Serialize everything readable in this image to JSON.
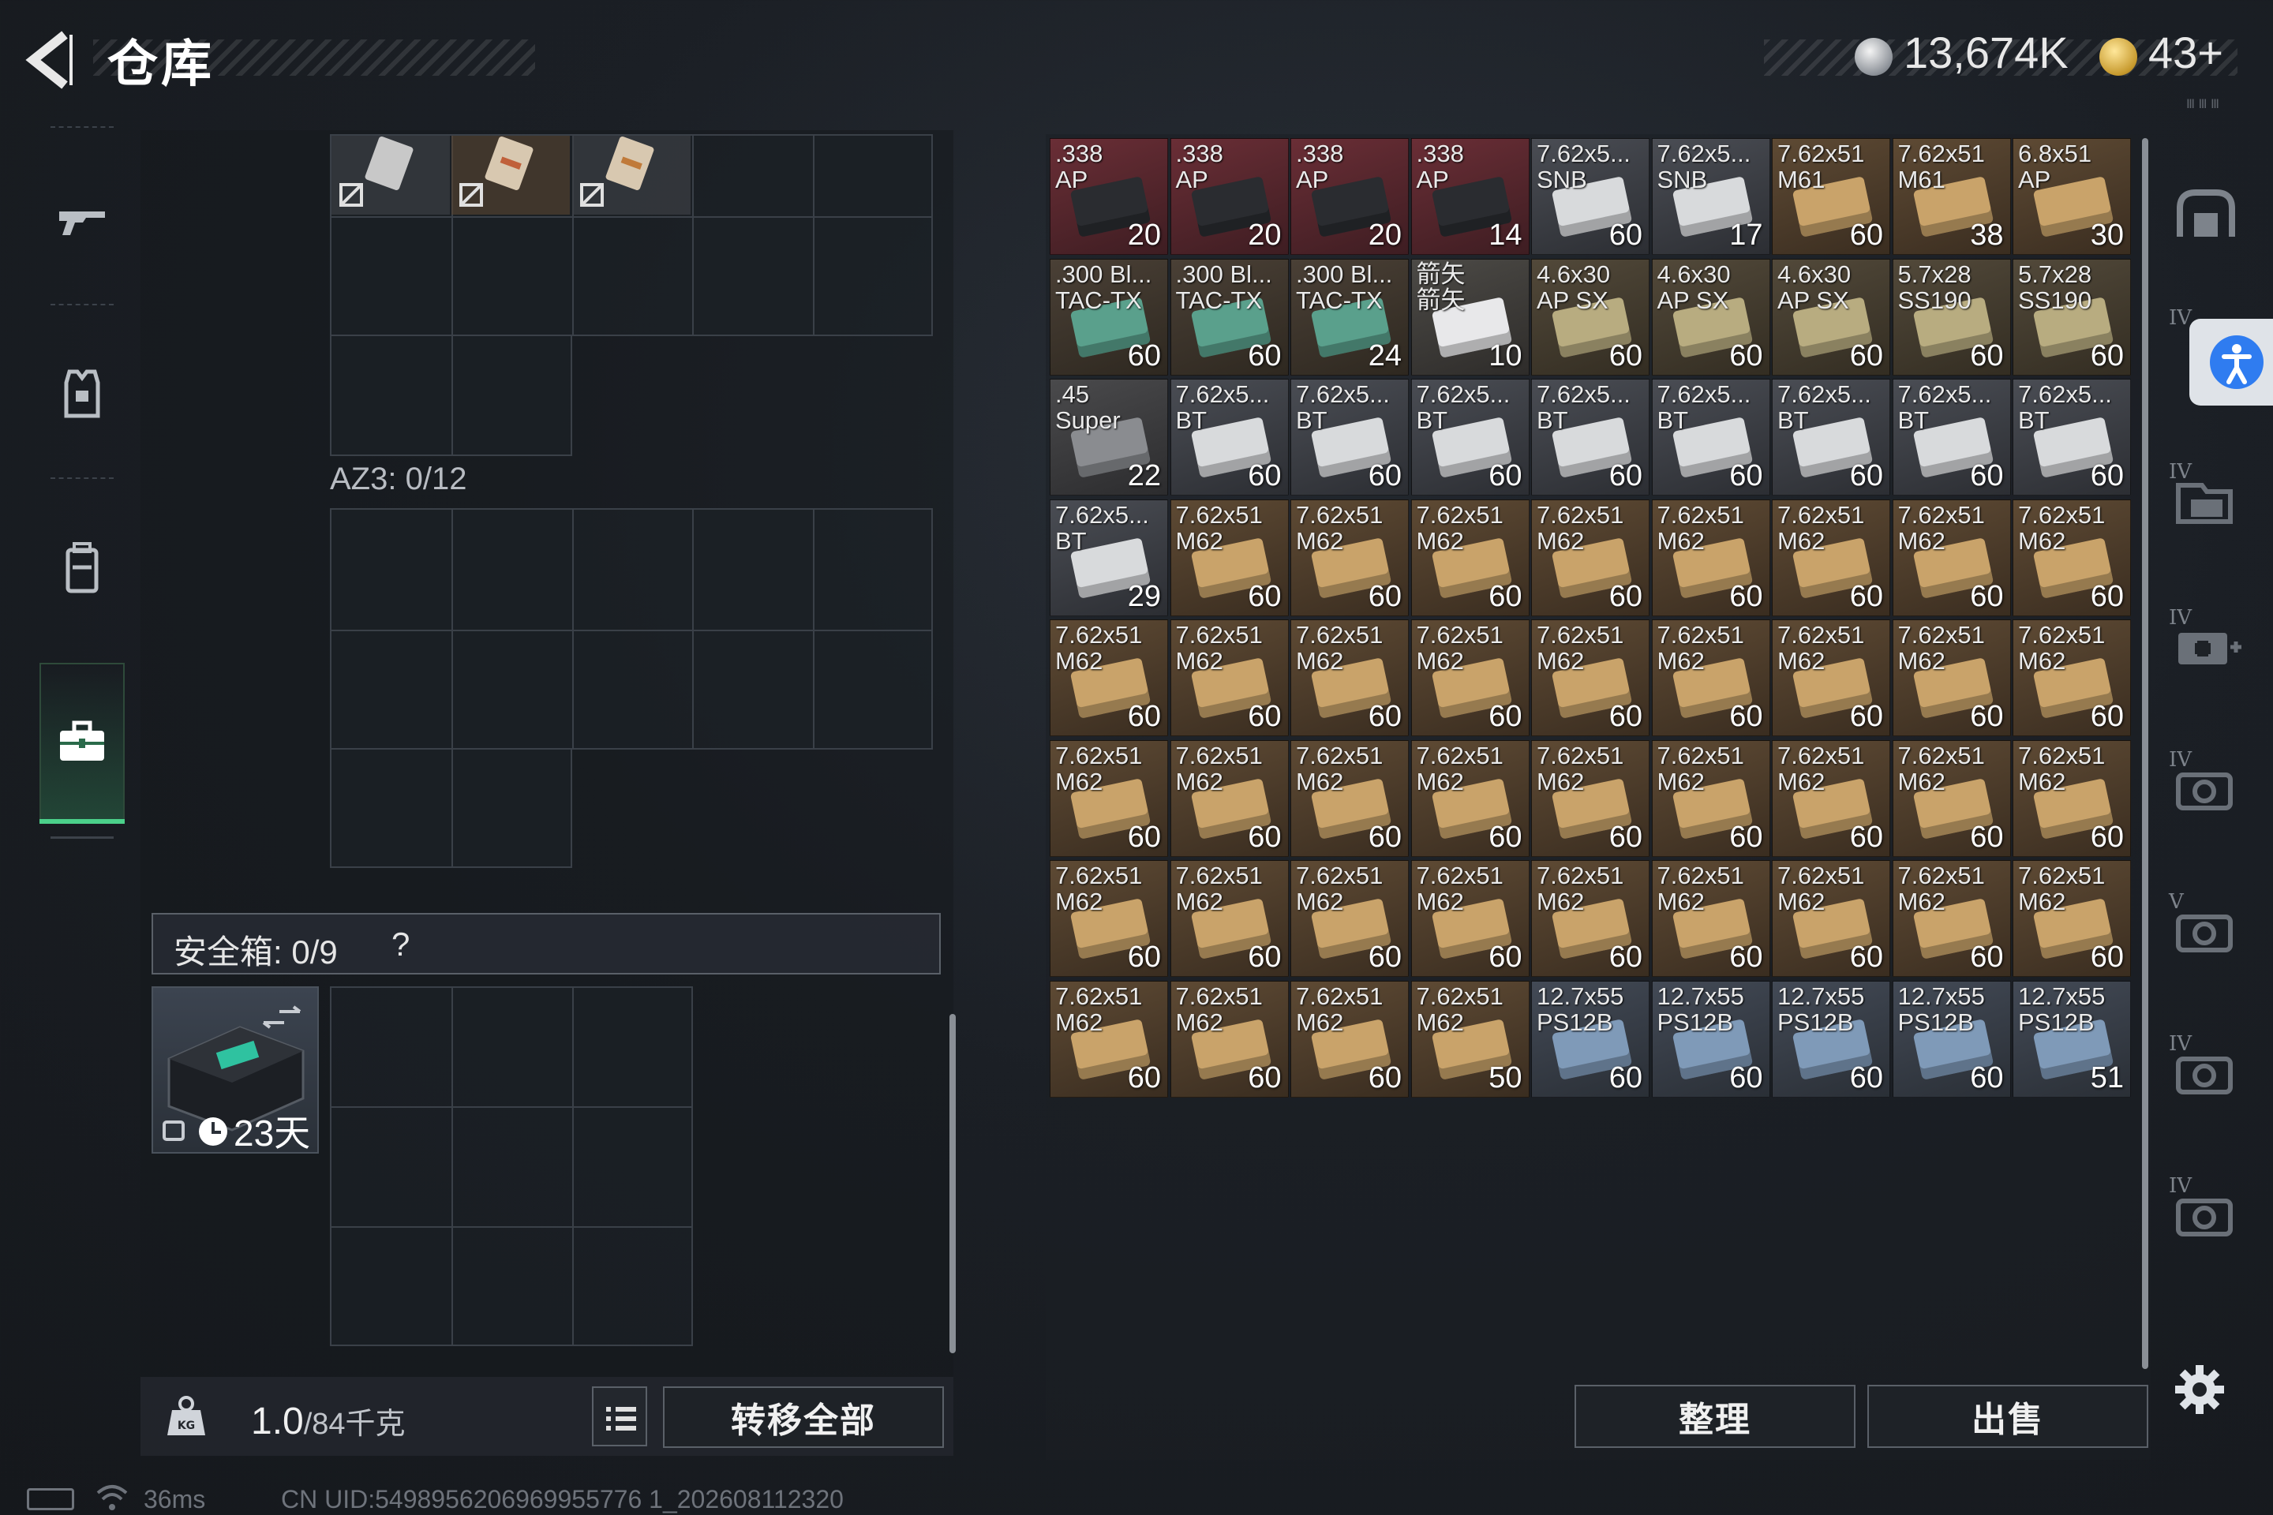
{
  "header": {
    "title": "仓库",
    "silver_amount": "13,674K",
    "gold_amount": "43+",
    "corner_mark": "Ⅲ Ⅲ Ⅲ"
  },
  "left_nav": {
    "items": [
      {
        "name": "weapon",
        "icon": "gun-icon"
      },
      {
        "name": "armor",
        "icon": "vest-icon"
      },
      {
        "name": "backpack",
        "icon": "backpack-icon"
      },
      {
        "name": "case",
        "icon": "briefcase-icon",
        "active": true
      }
    ]
  },
  "container": {
    "az3_label": "AZ3: 0/12"
  },
  "safebox": {
    "label": "安全箱: 0/9",
    "help": "?",
    "days": "23天"
  },
  "bottom_bar": {
    "weight": "1.0",
    "weight_max": "/84千克",
    "transfer_all": "转移全部"
  },
  "status": {
    "ping": "36ms",
    "uid": "CN UID:5498956206969955776 1_202608112320"
  },
  "storage": {
    "items": [
      {
        "name": ".338\nAP",
        "count": "20",
        "kind": "ap338"
      },
      {
        "name": ".338\nAP",
        "count": "20",
        "kind": "ap338"
      },
      {
        "name": ".338\nAP",
        "count": "20",
        "kind": "ap338"
      },
      {
        "name": ".338\nAP",
        "count": "14",
        "kind": "ap338"
      },
      {
        "name": "7.62x5...\nSNB",
        "count": "60",
        "kind": "silver"
      },
      {
        "name": "7.62x5...\nSNB",
        "count": "17",
        "kind": "silver"
      },
      {
        "name": "7.62x51\nM61",
        "count": "60",
        "kind": "gold"
      },
      {
        "name": "7.62x51\nM61",
        "count": "38",
        "kind": "gold"
      },
      {
        "name": "6.8x51\nAP",
        "count": "30",
        "kind": "gold"
      },
      {
        "name": ".300 Bl...\nTAC-TX",
        "count": "60",
        "kind": "teal"
      },
      {
        "name": ".300 Bl...\nTAC-TX",
        "count": "60",
        "kind": "teal"
      },
      {
        "name": ".300 Bl...\nTAC-TX",
        "count": "24",
        "kind": "teal"
      },
      {
        "name": "箭矢\n箭矢",
        "count": "10",
        "kind": "white"
      },
      {
        "name": "4.6x30\nAP SX",
        "count": "60",
        "kind": "khaki"
      },
      {
        "name": "4.6x30\nAP SX",
        "count": "60",
        "kind": "khaki"
      },
      {
        "name": "4.6x30\nAP SX",
        "count": "60",
        "kind": "khaki"
      },
      {
        "name": "5.7x28\nSS190",
        "count": "60",
        "kind": "khaki"
      },
      {
        "name": "5.7x28\nSS190",
        "count": "60",
        "kind": "khaki"
      },
      {
        "name": ".45\nSuper",
        "count": "22",
        "kind": "slate"
      },
      {
        "name": "7.62x5...\nBT",
        "count": "60",
        "kind": "silver"
      },
      {
        "name": "7.62x5...\nBT",
        "count": "60",
        "kind": "silver"
      },
      {
        "name": "7.62x5...\nBT",
        "count": "60",
        "kind": "silver"
      },
      {
        "name": "7.62x5...\nBT",
        "count": "60",
        "kind": "silver"
      },
      {
        "name": "7.62x5...\nBT",
        "count": "60",
        "kind": "silver"
      },
      {
        "name": "7.62x5...\nBT",
        "count": "60",
        "kind": "silver"
      },
      {
        "name": "7.62x5...\nBT",
        "count": "60",
        "kind": "silver"
      },
      {
        "name": "7.62x5...\nBT",
        "count": "60",
        "kind": "silver"
      },
      {
        "name": "7.62x5...\nBT",
        "count": "29",
        "kind": "silver"
      },
      {
        "name": "7.62x51\nM62",
        "count": "60",
        "kind": "gold"
      },
      {
        "name": "7.62x51\nM62",
        "count": "60",
        "kind": "gold"
      },
      {
        "name": "7.62x51\nM62",
        "count": "60",
        "kind": "gold"
      },
      {
        "name": "7.62x51\nM62",
        "count": "60",
        "kind": "gold"
      },
      {
        "name": "7.62x51\nM62",
        "count": "60",
        "kind": "gold"
      },
      {
        "name": "7.62x51\nM62",
        "count": "60",
        "kind": "gold"
      },
      {
        "name": "7.62x51\nM62",
        "count": "60",
        "kind": "gold"
      },
      {
        "name": "7.62x51\nM62",
        "count": "60",
        "kind": "gold"
      },
      {
        "name": "7.62x51\nM62",
        "count": "60",
        "kind": "gold"
      },
      {
        "name": "7.62x51\nM62",
        "count": "60",
        "kind": "gold"
      },
      {
        "name": "7.62x51\nM62",
        "count": "60",
        "kind": "gold"
      },
      {
        "name": "7.62x51\nM62",
        "count": "60",
        "kind": "gold"
      },
      {
        "name": "7.62x51\nM62",
        "count": "60",
        "kind": "gold"
      },
      {
        "name": "7.62x51\nM62",
        "count": "60",
        "kind": "gold"
      },
      {
        "name": "7.62x51\nM62",
        "count": "60",
        "kind": "gold"
      },
      {
        "name": "7.62x51\nM62",
        "count": "60",
        "kind": "gold"
      },
      {
        "name": "7.62x51\nM62",
        "count": "60",
        "kind": "gold"
      },
      {
        "name": "7.62x51\nM62",
        "count": "60",
        "kind": "gold"
      },
      {
        "name": "7.62x51\nM62",
        "count": "60",
        "kind": "gold"
      },
      {
        "name": "7.62x51\nM62",
        "count": "60",
        "kind": "gold"
      },
      {
        "name": "7.62x51\nM62",
        "count": "60",
        "kind": "gold"
      },
      {
        "name": "7.62x51\nM62",
        "count": "60",
        "kind": "gold"
      },
      {
        "name": "7.62x51\nM62",
        "count": "60",
        "kind": "gold"
      },
      {
        "name": "7.62x51\nM62",
        "count": "60",
        "kind": "gold"
      },
      {
        "name": "7.62x51\nM62",
        "count": "60",
        "kind": "gold"
      },
      {
        "name": "7.62x51\nM62",
        "count": "60",
        "kind": "gold"
      },
      {
        "name": "7.62x51\nM62",
        "count": "60",
        "kind": "gold"
      },
      {
        "name": "7.62x51\nM62",
        "count": "60",
        "kind": "gold"
      },
      {
        "name": "7.62x51\nM62",
        "count": "60",
        "kind": "gold"
      },
      {
        "name": "7.62x51\nM62",
        "count": "60",
        "kind": "gold"
      },
      {
        "name": "7.62x51\nM62",
        "count": "60",
        "kind": "gold"
      },
      {
        "name": "7.62x51\nM62",
        "count": "60",
        "kind": "gold"
      },
      {
        "name": "7.62x51\nM62",
        "count": "60",
        "kind": "gold"
      },
      {
        "name": "7.62x51\nM62",
        "count": "60",
        "kind": "gold"
      },
      {
        "name": "7.62x51\nM62",
        "count": "60",
        "kind": "gold"
      },
      {
        "name": "7.62x51\nM62",
        "count": "60",
        "kind": "gold"
      },
      {
        "name": "7.62x51\nM62",
        "count": "60",
        "kind": "gold"
      },
      {
        "name": "7.62x51\nM62",
        "count": "60",
        "kind": "gold"
      },
      {
        "name": "7.62x51\nM62",
        "count": "50",
        "kind": "gold"
      },
      {
        "name": "12.7x55\nPS12B",
        "count": "60",
        "kind": "blue"
      },
      {
        "name": "12.7x55\nPS12B",
        "count": "60",
        "kind": "blue"
      },
      {
        "name": "12.7x55\nPS12B",
        "count": "60",
        "kind": "blue"
      },
      {
        "name": "12.7x55\nPS12B",
        "count": "60",
        "kind": "blue"
      },
      {
        "name": "12.7x55\nPS12B",
        "count": "51",
        "kind": "blue"
      }
    ]
  },
  "actions": {
    "sort": "整理",
    "sell": "出售"
  },
  "right_nav": {
    "tiers": [
      "IV",
      "IV",
      "IV",
      "IV",
      "V",
      "IV",
      "IV"
    ]
  },
  "colors": {
    "accent_green": "#4bd08a",
    "ap338": "#5a2a30",
    "silver": "#4b4e55",
    "gold": "#5a4632",
    "teal": "#3a4a4a",
    "white": "#50535a",
    "khaki": "#4c4734",
    "slate": "#45484e",
    "blue": "#3c4656"
  }
}
